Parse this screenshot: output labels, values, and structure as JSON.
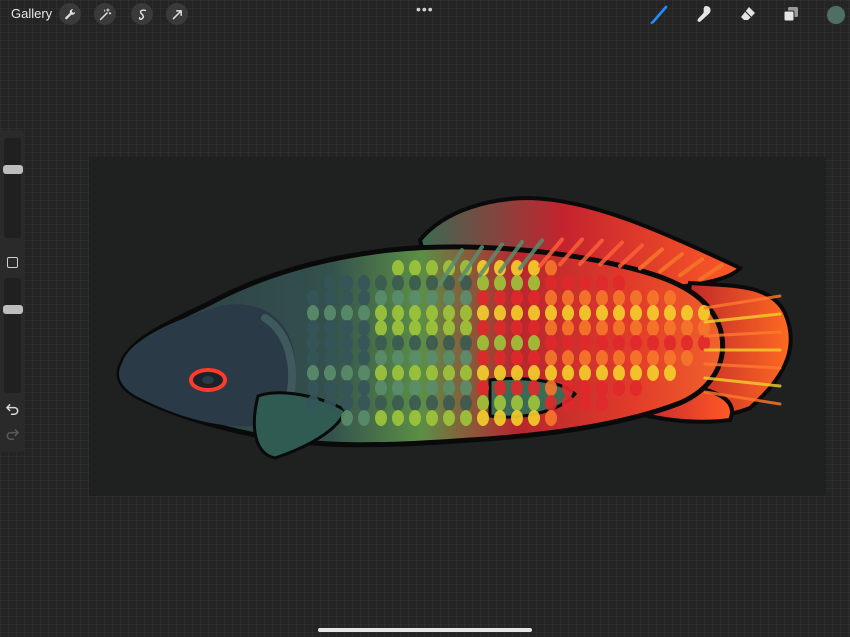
{
  "topbar": {
    "gallery_label": "Gallery",
    "left_tools": [
      "wrench-icon",
      "magic-wand-icon",
      "selection-icon",
      "transform-arrow-icon"
    ],
    "more_label": "•••",
    "right_tools": [
      "brush-icon",
      "smudge-icon",
      "eraser-icon",
      "layers-icon"
    ],
    "active_tool": "brush-icon",
    "current_color": "#4f6f66",
    "accent_color": "#1f8fff"
  },
  "sidebar": {
    "brush_size": 0.7,
    "opacity": 0.75
  },
  "canvas": {
    "artwork": "fish-illustration",
    "colors": [
      "#2e3e44",
      "#5a8d6c",
      "#9fc53a",
      "#e0282b",
      "#f5772a",
      "#f4d02b"
    ]
  }
}
